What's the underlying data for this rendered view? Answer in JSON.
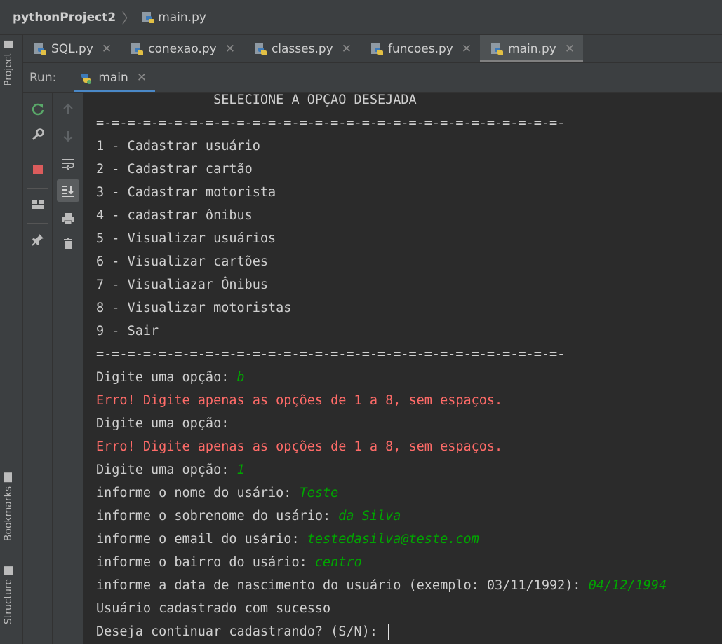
{
  "breadcrumb": {
    "project": "pythonProject2",
    "file": "main.py"
  },
  "left_strip": {
    "project_label": "Project",
    "bookmarks_label": "Bookmarks",
    "structure_label": "Structure"
  },
  "tabs": [
    {
      "label": "SQL.py",
      "active": false
    },
    {
      "label": "conexao.py",
      "active": false
    },
    {
      "label": "classes.py",
      "active": false
    },
    {
      "label": "funcoes.py",
      "active": false
    },
    {
      "label": "main.py",
      "active": true
    }
  ],
  "run": {
    "label": "Run:",
    "tab": "main"
  },
  "console": {
    "lines": [
      {
        "text": "               SELECIONE A OPÇÃO DESEJADA"
      },
      {
        "text": "=-=-=-=-=-=-=-=-=-=-=-=-=-=-=-=-=-=-=-=-=-=-=-=-=-=-=-=-=-=-"
      },
      {
        "text": "1 - Cadastrar usuário"
      },
      {
        "text": "2 - Cadastrar cartão"
      },
      {
        "text": "3 - Cadastrar motorista"
      },
      {
        "text": "4 - cadastrar ônibus"
      },
      {
        "text": "5 - Visualizar usuários"
      },
      {
        "text": "6 - Visualizar cartões"
      },
      {
        "text": "7 - Visualiazar Ônibus"
      },
      {
        "text": "8 - Visualizar motoristas"
      },
      {
        "text": "9 - Sair"
      },
      {
        "text": "=-=-=-=-=-=-=-=-=-=-=-=-=-=-=-=-=-=-=-=-=-=-=-=-=-=-=-=-=-=-"
      },
      {
        "text": "Digite uma opção: ",
        "input": "b"
      },
      {
        "text": "Erro! Digite apenas as opções de 1 a 8, sem espaços.",
        "error": true
      },
      {
        "text": "Digite uma opção: "
      },
      {
        "text": "Erro! Digite apenas as opções de 1 a 8, sem espaços.",
        "error": true
      },
      {
        "text": "Digite uma opção: ",
        "input": "1"
      },
      {
        "text": "informe o nome do usário: ",
        "input": "Teste"
      },
      {
        "text": "informe o sobrenome do usário: ",
        "input": "da Silva"
      },
      {
        "text": "informe o email do usário: ",
        "input": "testedasilva@teste.com"
      },
      {
        "text": "informe o bairro do usário: ",
        "input": "centro"
      },
      {
        "text": "informe a data de nascimento do usuário (exemplo: 03/11/1992): ",
        "input": "04/12/1994"
      },
      {
        "text": "Usuário cadastrado com sucesso"
      },
      {
        "text": "Deseja continuar cadastrando? (S/N): ",
        "caret": true
      }
    ]
  }
}
